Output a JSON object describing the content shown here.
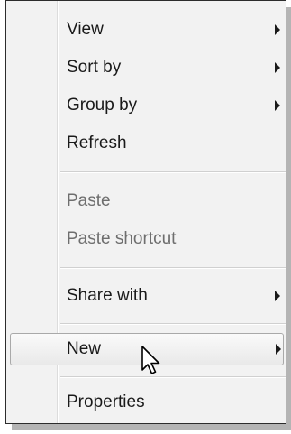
{
  "menu": {
    "items": [
      {
        "label": "View",
        "submenu": true,
        "enabled": true
      },
      {
        "label": "Sort by",
        "submenu": true,
        "enabled": true
      },
      {
        "label": "Group by",
        "submenu": true,
        "enabled": true
      },
      {
        "label": "Refresh",
        "submenu": false,
        "enabled": true
      },
      {
        "label": "Paste",
        "submenu": false,
        "enabled": false
      },
      {
        "label": "Paste shortcut",
        "submenu": false,
        "enabled": false
      },
      {
        "label": "Share with",
        "submenu": true,
        "enabled": true
      },
      {
        "label": "New",
        "submenu": true,
        "enabled": true,
        "highlighted": true
      },
      {
        "label": "Properties",
        "submenu": false,
        "enabled": true
      }
    ]
  },
  "cursor": {
    "icon": "arrow-pointer-icon"
  },
  "colors": {
    "menu_bg": "#f2f2f2",
    "border": "#2c2c2c",
    "highlight_border": "#a9a9a9",
    "disabled_text": "#6e6e6e"
  }
}
